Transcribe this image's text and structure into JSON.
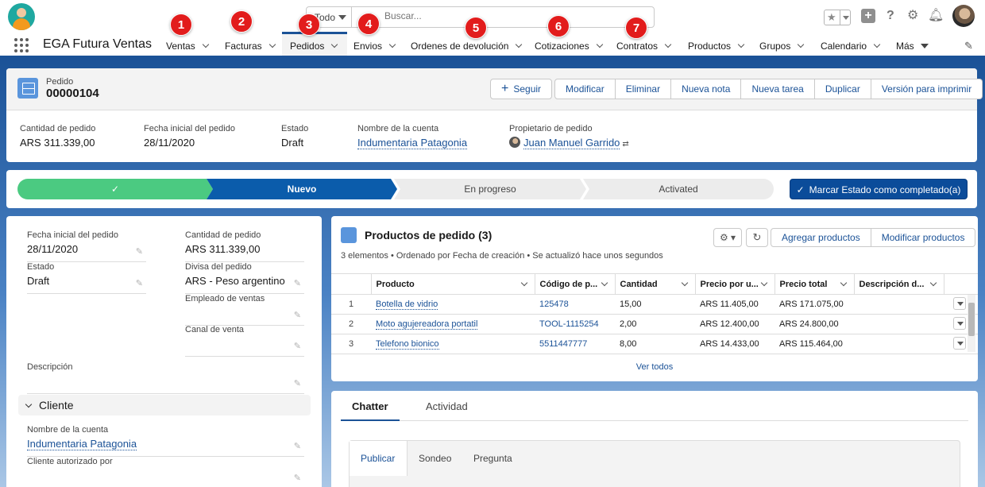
{
  "header": {
    "search": {
      "scope": "Todo",
      "placeholder": "Buscar..."
    }
  },
  "nav": {
    "app_name": "EGA Futura Ventas",
    "items": [
      {
        "label": "Ventas",
        "badge": "1"
      },
      {
        "label": "Facturas",
        "badge": "2"
      },
      {
        "label": "Pedidos",
        "badge": "3"
      },
      {
        "label": "Envios",
        "badge": "4"
      },
      {
        "label": "Ordenes de devolución",
        "badge": "5"
      },
      {
        "label": "Cotizaciones",
        "badge": "6"
      },
      {
        "label": "Contratos",
        "badge": "7"
      },
      {
        "label": "Productos"
      },
      {
        "label": "Grupos"
      },
      {
        "label": "Calendario"
      },
      {
        "label": "Más"
      }
    ]
  },
  "record": {
    "type": "Pedido",
    "name": "00000104",
    "actions": [
      "Seguir",
      "Modificar",
      "Eliminar",
      "Nueva nota",
      "Nueva tarea",
      "Duplicar",
      "Versión para imprimir"
    ],
    "highlights": [
      {
        "label": "Cantidad de pedido",
        "value": "ARS 311.339,00"
      },
      {
        "label": "Fecha inicial del pedido",
        "value": "28/11/2020"
      },
      {
        "label": "Estado",
        "value": "Draft"
      },
      {
        "label": "Nombre de la cuenta",
        "value": "Indumentaria Patagonia"
      },
      {
        "label": "Propietario de pedido",
        "value": "Juan Manuel Garrido"
      }
    ]
  },
  "path": {
    "stages": [
      "✓",
      "Nuevo",
      "En progreso",
      "Activated"
    ],
    "mark_button": "Marcar Estado como completado(a)"
  },
  "details": {
    "fields": [
      {
        "label": "Fecha inicial del pedido",
        "value": "28/11/2020"
      },
      {
        "label": "Cantidad de pedido",
        "value": "ARS 311.339,00"
      },
      {
        "label": "Estado",
        "value": "Draft"
      },
      {
        "label": "Divisa del pedido",
        "value": "ARS - Peso argentino"
      },
      {
        "label": "Empleado de ventas",
        "value": ""
      },
      {
        "label": "Canal de venta",
        "value": ""
      },
      {
        "label": "Descripción",
        "value": ""
      }
    ],
    "section_cliente": "Cliente",
    "cliente_fields": [
      {
        "label": "Nombre de la cuenta",
        "value": "Indumentaria Patagonia"
      },
      {
        "label": "Cliente autorizado por",
        "value": ""
      }
    ]
  },
  "products": {
    "title": "Productos de pedido (3)",
    "subtitle": "3 elementos • Ordenado por Fecha de creación • Se actualizó hace unos segundos",
    "buttons": [
      "Agregar productos",
      "Modificar productos"
    ],
    "columns": [
      "Producto",
      "Código de p...",
      "Cantidad",
      "Precio por u...",
      "Precio total",
      "Descripción d..."
    ],
    "rows": [
      {
        "n": "1",
        "producto": "Botella de vidrio",
        "codigo": "125478",
        "cantidad": "15,00",
        "precio": "ARS 11.405,00",
        "total": "ARS 171.075,00"
      },
      {
        "n": "2",
        "producto": "Moto agujereadora portatil",
        "codigo": "TOOL-1115254",
        "cantidad": "2,00",
        "precio": "ARS 12.400,00",
        "total": "ARS 24.800,00"
      },
      {
        "n": "3",
        "producto": "Telefono bionico",
        "codigo": "5511447777",
        "cantidad": "8,00",
        "precio": "ARS 14.433,00",
        "total": "ARS 115.464,00"
      }
    ],
    "view_all": "Ver todos"
  },
  "chatter": {
    "tabs": [
      "Chatter",
      "Actividad"
    ],
    "publisher_tabs": [
      "Publicar",
      "Sondeo",
      "Pregunta"
    ]
  },
  "colors": {
    "brand": "#1b5297",
    "path_complete": "#4bca81",
    "path_current": "#0b5cab",
    "badge": "#e21c1c"
  }
}
